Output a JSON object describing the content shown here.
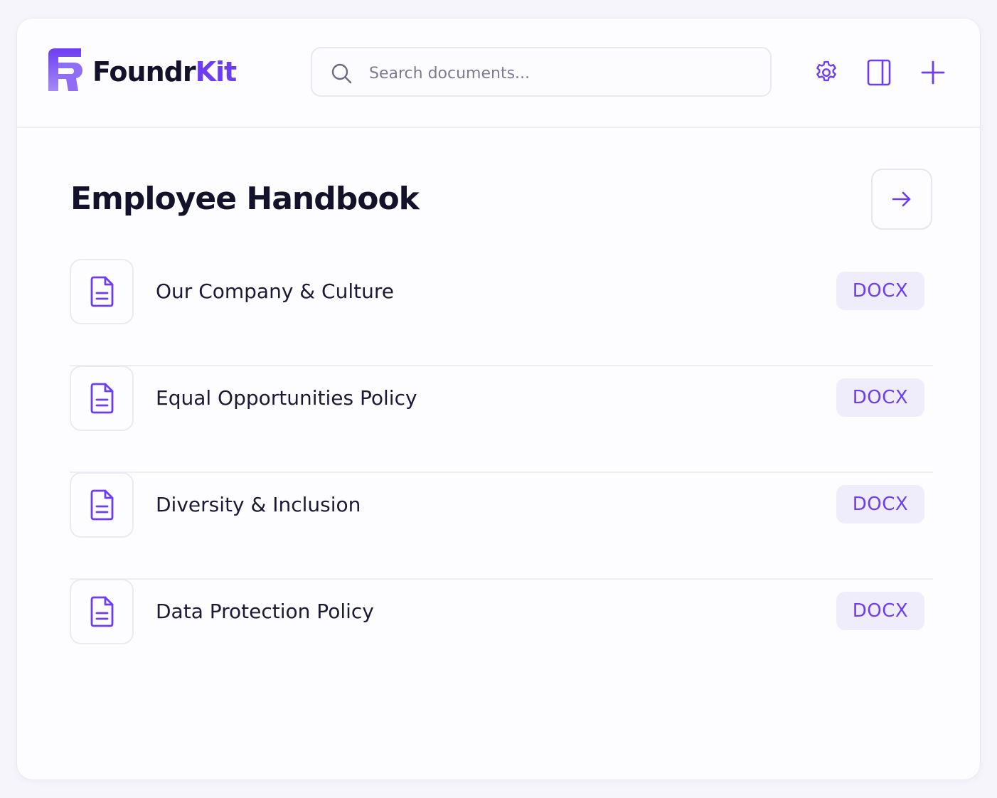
{
  "brand": {
    "name_primary": "Foundr",
    "name_accent": "Kit",
    "accent_color": "#6d3df2"
  },
  "header": {
    "search_placeholder": "Search documents...",
    "icons": [
      "search-icon",
      "gear-icon",
      "sidebar-panel-icon",
      "plus-icon"
    ]
  },
  "main": {
    "title": "Employee Handbook",
    "open_icon": "arrow-right-icon",
    "documents": [
      {
        "name": "Our Company & Culture",
        "type": "DOCX",
        "icon": "document-icon"
      },
      {
        "name": "Equal Opportunities Policy",
        "type": "DOCX",
        "icon": "document-icon"
      },
      {
        "name": "Diversity & Inclusion",
        "type": "DOCX",
        "icon": "document-icon"
      },
      {
        "name": "Data Protection Policy",
        "type": "DOCX",
        "icon": "document-icon"
      }
    ]
  },
  "colors": {
    "accent": "#6d3df2",
    "badge_bg": "#efedfb",
    "text": "#14122b",
    "muted": "#7d7a93"
  }
}
